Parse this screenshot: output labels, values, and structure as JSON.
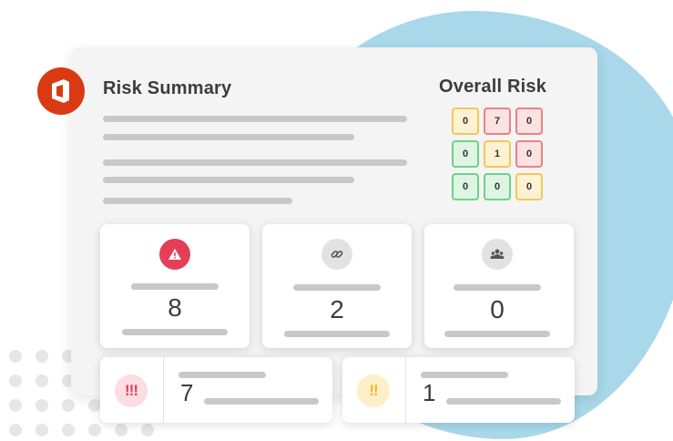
{
  "summary": {
    "title": "Risk Summary"
  },
  "overall_risk": {
    "title": "Overall Risk",
    "matrix": [
      [
        {
          "value": "0",
          "level": "y"
        },
        {
          "value": "7",
          "level": "r"
        },
        {
          "value": "0",
          "level": "r"
        }
      ],
      [
        {
          "value": "0",
          "level": "g"
        },
        {
          "value": "1",
          "level": "y"
        },
        {
          "value": "0",
          "level": "r"
        }
      ],
      [
        {
          "value": "0",
          "level": "g"
        },
        {
          "value": "0",
          "level": "g"
        },
        {
          "value": "0",
          "level": "y"
        }
      ]
    ]
  },
  "cards": [
    {
      "icon": "warning-icon",
      "value": "8"
    },
    {
      "icon": "link-icon",
      "value": "2"
    },
    {
      "icon": "users-icon",
      "value": "0"
    }
  ],
  "severity_cards": [
    {
      "icon": "critical-exclamation-icon",
      "symbol": "!!!",
      "value": "7"
    },
    {
      "icon": "high-exclamation-icon",
      "symbol": "!!",
      "value": "1"
    }
  ],
  "colors": {
    "brand": "#d93a11",
    "critical": "#e34057",
    "warning": "#f5b51f",
    "low": "#6fd18a",
    "accent_bg": "#a8d8ea"
  }
}
